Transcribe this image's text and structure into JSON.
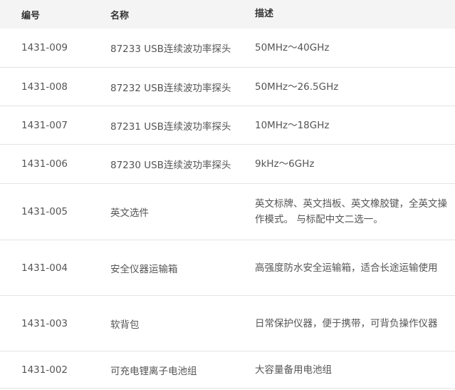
{
  "table": {
    "headers": {
      "code": "编号",
      "name": "名称",
      "desc": "描述"
    },
    "rows": [
      {
        "code": "1431-009",
        "name": "87233 USB连续波功率探头",
        "desc": "50MHz～40GHz"
      },
      {
        "code": "1431-008",
        "name": "87232 USB连续波功率探头",
        "desc": "50MHz～26.5GHz"
      },
      {
        "code": "1431-007",
        "name": "87231 USB连续波功率探头",
        "desc": "10MHz～18GHz"
      },
      {
        "code": "1431-006",
        "name": "87230 USB连续波功率探头",
        "desc": "9kHz～6GHz"
      },
      {
        "code": "1431-005",
        "name": "英文选件",
        "desc": "英文标牌、英文挡板、英文橡胶键，全英文操作模式。 与标配中文二选一。"
      },
      {
        "code": "1431-004",
        "name": "安全仪器运输箱",
        "desc": "高强度防水安全运输箱，适合长途运输使用"
      },
      {
        "code": "1431-003",
        "name": "软背包",
        "desc": "日常保护仪器，便于携带，可背负操作仪器"
      },
      {
        "code": "1431-002",
        "name": "可充电锂离子电池组",
        "desc": "大容量备用电池组"
      }
    ]
  }
}
